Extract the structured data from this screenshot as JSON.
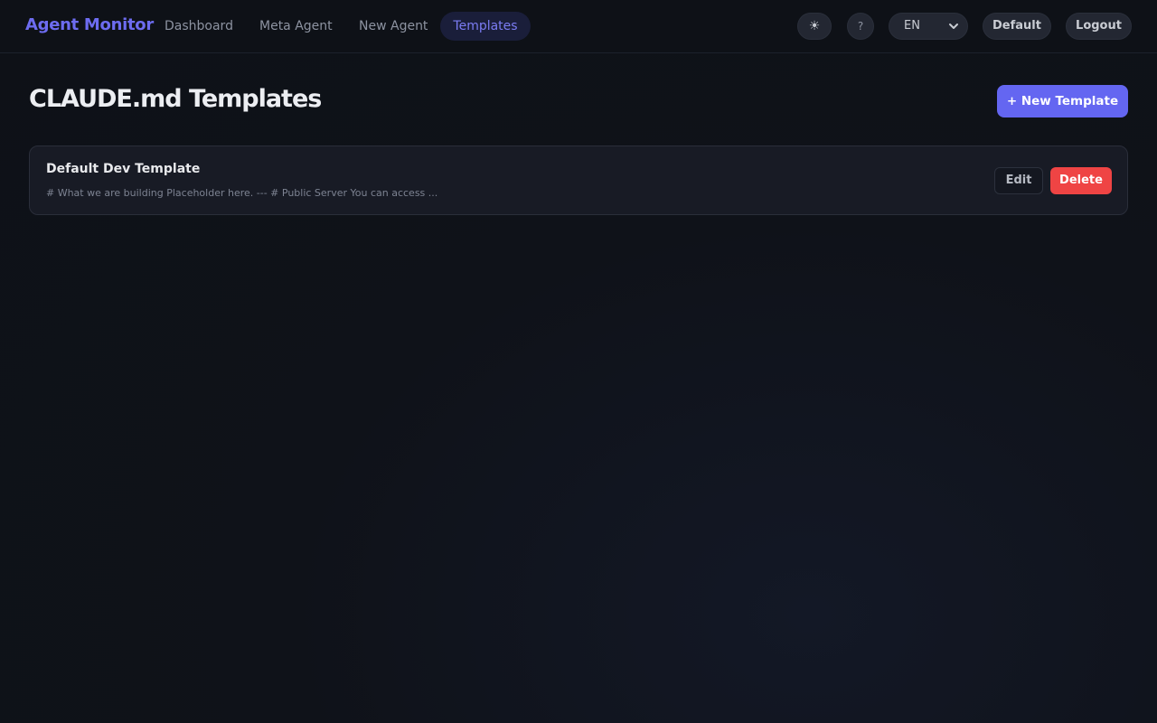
{
  "header": {
    "brand": "Agent Monitor",
    "nav": {
      "dashboard": "Dashboard",
      "meta_agent": "Meta Agent",
      "new_agent": "New Agent",
      "templates": "Templates"
    },
    "active_nav": "templates",
    "theme_icon": "sun-icon",
    "theme_glyph": "☀",
    "help_label": "?",
    "language": {
      "selected": "EN"
    },
    "profile_label": "Default",
    "logout_label": "Logout"
  },
  "main": {
    "title": "CLAUDE.md Templates",
    "new_button_label": "+ New Template",
    "templates": [
      {
        "name": "Default Dev Template",
        "preview": "# What we are building Placeholder here. --- # Public Server You can access ...",
        "edit_label": "Edit",
        "delete_label": "Delete"
      }
    ]
  },
  "colors": {
    "background": "#0e1117",
    "accent": "#6466f1",
    "brand": "#6d6cf0",
    "danger": "#ef4444",
    "card": "#181b25"
  }
}
